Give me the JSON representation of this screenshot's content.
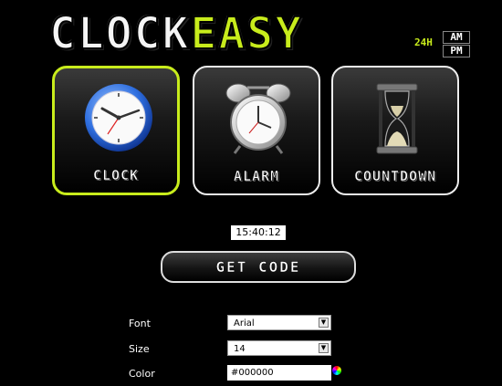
{
  "logo": {
    "part1": "CLOCK",
    "part2": "EASY"
  },
  "format": {
    "h24": "24H",
    "am": "AM",
    "pm": "PM"
  },
  "tiles": [
    {
      "label": "CLOCK",
      "icon": "wall-clock-icon",
      "active": true
    },
    {
      "label": "ALARM",
      "icon": "alarm-clock-icon",
      "active": false
    },
    {
      "label": "COUNTDOWN",
      "icon": "hourglass-icon",
      "active": false
    }
  ],
  "time": "15:40:12",
  "get_code_label": "GET CODE",
  "form": {
    "font_label": "Font",
    "font_value": "Arial",
    "size_label": "Size",
    "size_value": "14",
    "color_label": "Color",
    "color_value": "#000000"
  },
  "colors": {
    "accent": "#c8ec1c",
    "background": "#000000"
  }
}
